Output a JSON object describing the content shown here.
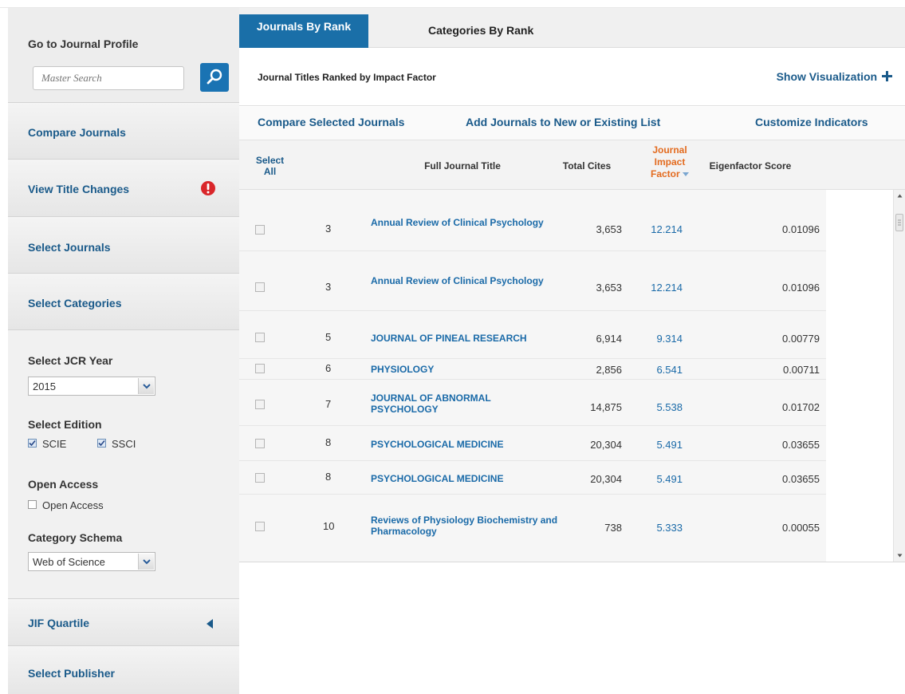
{
  "sidebar": {
    "search_title": "Go to Journal Profile",
    "search_placeholder": "Master Search",
    "links": {
      "compare": "Compare Journals",
      "title_changes": "View Title Changes",
      "select_journals": "Select Journals",
      "select_categories": "Select Categories",
      "jif_quartile": "JIF Quartile",
      "select_publisher": "Select Publisher"
    },
    "alert_color": "#d9262a",
    "filters": {
      "year_label": "Select JCR Year",
      "year_value": "2015",
      "edition_label": "Select Edition",
      "edition_scie": "SCIE",
      "edition_ssci": "SSCI",
      "open_access_label": "Open Access",
      "open_access_option": "Open Access",
      "schema_label": "Category Schema",
      "schema_value": "Web of Science"
    }
  },
  "tabs": {
    "active": "Journals By Rank",
    "other": "Categories By Rank"
  },
  "header": {
    "ranking_title": "Journal Titles Ranked by Impact Factor",
    "show_visualization": "Show Visualization"
  },
  "actions": {
    "compare_selected": "Compare Selected Journals",
    "add_to_list": "Add Journals to New or Existing List",
    "customize": "Customize Indicators"
  },
  "table": {
    "headers": {
      "select_all_1": "Select",
      "select_all_2": "All",
      "full_title": "Full Journal Title",
      "total_cites": "Total Cites",
      "jif_1": "Journal",
      "jif_2": "Impact",
      "jif_3": "Factor",
      "eigenfactor": "Eigenfactor Score"
    },
    "rows": [
      {
        "rank": "3",
        "title": "Annual Review of Clinical Psychology",
        "cites": "3,653",
        "jif": "12.214",
        "eigen": "0.01096"
      },
      {
        "rank": "3",
        "title": "Annual Review of Clinical Psychology",
        "cites": "3,653",
        "jif": "12.214",
        "eigen": "0.01096"
      },
      {
        "rank": "5",
        "title": "JOURNAL OF PINEAL RESEARCH",
        "cites": "6,914",
        "jif": "9.314",
        "eigen": "0.00779"
      },
      {
        "rank": "6",
        "title": "PHYSIOLOGY",
        "cites": "2,856",
        "jif": "6.541",
        "eigen": "0.00711"
      },
      {
        "rank": "7",
        "title": "JOURNAL OF ABNORMAL PSYCHOLOGY",
        "cites": "14,875",
        "jif": "5.538",
        "eigen": "0.01702"
      },
      {
        "rank": "8",
        "title": "PSYCHOLOGICAL MEDICINE",
        "cites": "20,304",
        "jif": "5.491",
        "eigen": "0.03655"
      },
      {
        "rank": "8",
        "title": "PSYCHOLOGICAL MEDICINE",
        "cites": "20,304",
        "jif": "5.491",
        "eigen": "0.03655"
      },
      {
        "rank": "10",
        "title": "Reviews of Physiology Biochemistry and Pharmacology",
        "cites": "738",
        "jif": "5.333",
        "eigen": "0.00055"
      }
    ]
  }
}
